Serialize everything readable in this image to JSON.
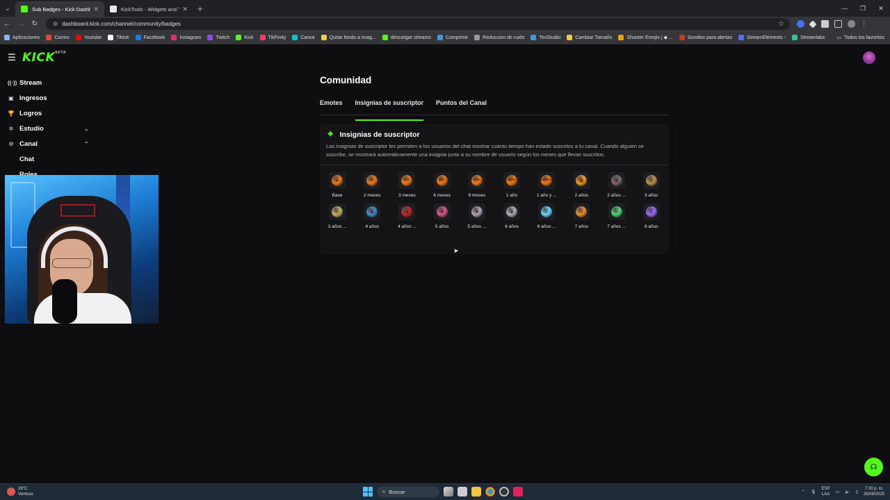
{
  "browser": {
    "tabs": [
      {
        "title": "Sub Badges - Kick Dashboard",
        "favicon_color": "#53fc18",
        "active": true
      },
      {
        "title": "KickTools - Widgets and Tools f",
        "favicon_color": "#e6e6e6",
        "active": false
      }
    ],
    "url": "dashboard.kick.com/channel/community/badges",
    "bookmarks": [
      {
        "label": "Aplicaciones",
        "color": "#8ab4f8"
      },
      {
        "label": "Correo",
        "color": "#ea4335"
      },
      {
        "label": "Youtube",
        "color": "#ff0000"
      },
      {
        "label": "Tiktok",
        "color": "#ffffff"
      },
      {
        "label": "Facebook",
        "color": "#1877f2"
      },
      {
        "label": "Instagram",
        "color": "#e1306c"
      },
      {
        "label": "Twitch",
        "color": "#9146ff"
      },
      {
        "label": "Kick",
        "color": "#53fc18"
      },
      {
        "label": "TikFinity",
        "color": "#ff3b6b"
      },
      {
        "label": "Canva",
        "color": "#00c4cc"
      },
      {
        "label": "Quitar fondo a imag...",
        "color": "#f2c94c"
      },
      {
        "label": "descargar streams",
        "color": "#53fc18"
      },
      {
        "label": "Comprimir",
        "color": "#4a90e2"
      },
      {
        "label": "Reduccion de ruido",
        "color": "#999999"
      },
      {
        "label": "TexStudio",
        "color": "#4a90e2"
      },
      {
        "label": "Cambiar Tamaño",
        "color": "#f2c94c"
      },
      {
        "label": "Shooter Emojis | ◆ ...",
        "color": "#f2a007"
      },
      {
        "label": "Sonidos para alertas",
        "color": "#c0392b"
      },
      {
        "label": "StreamElements -",
        "color": "#5b6cf5"
      },
      {
        "label": "Streamlabs",
        "color": "#31c3a2"
      }
    ],
    "bookmarks_more": "Todos los favoritos"
  },
  "kick": {
    "logo": "KICK",
    "logo_tag": "BETA",
    "sidebar": [
      {
        "label": "Stream",
        "icon": "broadcast-icon",
        "glyph": "((·))"
      },
      {
        "label": "Ingresos",
        "icon": "wallet-icon",
        "glyph": "▣"
      },
      {
        "label": "Logros",
        "icon": "trophy-icon",
        "glyph": "🏆"
      },
      {
        "label": "Estudio",
        "icon": "studio-icon",
        "glyph": "✲",
        "chevron": "⌄"
      },
      {
        "label": "Canal",
        "icon": "channel-icon",
        "glyph": "⚙",
        "chevron": "⌃"
      }
    ],
    "sidebar_sub": [
      "Chat",
      "Roles"
    ],
    "page_title": "Comunidad",
    "tabs": [
      "Emotes",
      "Insignias de suscriptor",
      "Puntos del Canal"
    ],
    "card": {
      "title": "Insignias de suscriptor",
      "description": "Las insignias de suscriptor les permiten a los usuarios del chat mostrar cuánto tiempo han estado suscritos a tu canal. Cuando alguien se suscribe, se mostrará automáticamente una insignia junto a su nombre de usuario según los meses que llevan suscritos."
    },
    "badges": [
      {
        "label": "Base",
        "color": "#f07a12",
        "stars": "★"
      },
      {
        "label": "2 meses",
        "color": "#f07a12",
        "stars": "••"
      },
      {
        "label": "3 meses",
        "color": "#f07a12",
        "stars": "•••"
      },
      {
        "label": "6 meses",
        "color": "#f07a12",
        "stars": "••••"
      },
      {
        "label": "9 meses",
        "color": "#f07a12",
        "stars": "•••••"
      },
      {
        "label": "1 año",
        "color": "#f07a12",
        "stars": "••••••"
      },
      {
        "label": "1 año y ...",
        "color": "#f07a12",
        "stars": "•••••••"
      },
      {
        "label": "2 años",
        "color": "#f0a21a",
        "stars": "▦"
      },
      {
        "label": "2 años ...",
        "color": "#7a6a6a",
        "stars": "◉"
      },
      {
        "label": "3 años",
        "color": "#b8964a",
        "stars": "◎"
      },
      {
        "label": "3 años ...",
        "color": "#c8b46a",
        "stars": "◎"
      },
      {
        "label": "4 años",
        "color": "#3f8fd6",
        "stars": "◉"
      },
      {
        "label": "4 años ...",
        "color": "#c02a2a",
        "stars": "◆"
      },
      {
        "label": "5 años",
        "color": "#d65a8a",
        "stars": "✺"
      },
      {
        "label": "5 años ...",
        "color": "#a8a8b8",
        "stars": "✺"
      },
      {
        "label": "6 años",
        "color": "#b0b0c0",
        "stars": "◉"
      },
      {
        "label": "6 años ...",
        "color": "#6ad6ff",
        "stars": "⚔"
      },
      {
        "label": "7 años",
        "color": "#f0902a",
        "stars": "⚔"
      },
      {
        "label": "7 años ...",
        "color": "#4ad67a",
        "stars": "⚔"
      },
      {
        "label": "8 años",
        "color": "#9a6aff",
        "stars": "⚔"
      }
    ]
  },
  "taskbar": {
    "weather_temp": "28°C",
    "weather_desc": "Ventoso",
    "search": "Buscar",
    "lang": "ESP",
    "lang_sub": "LAA",
    "time": "7:33 p. m.",
    "date": "26/08/2025"
  }
}
